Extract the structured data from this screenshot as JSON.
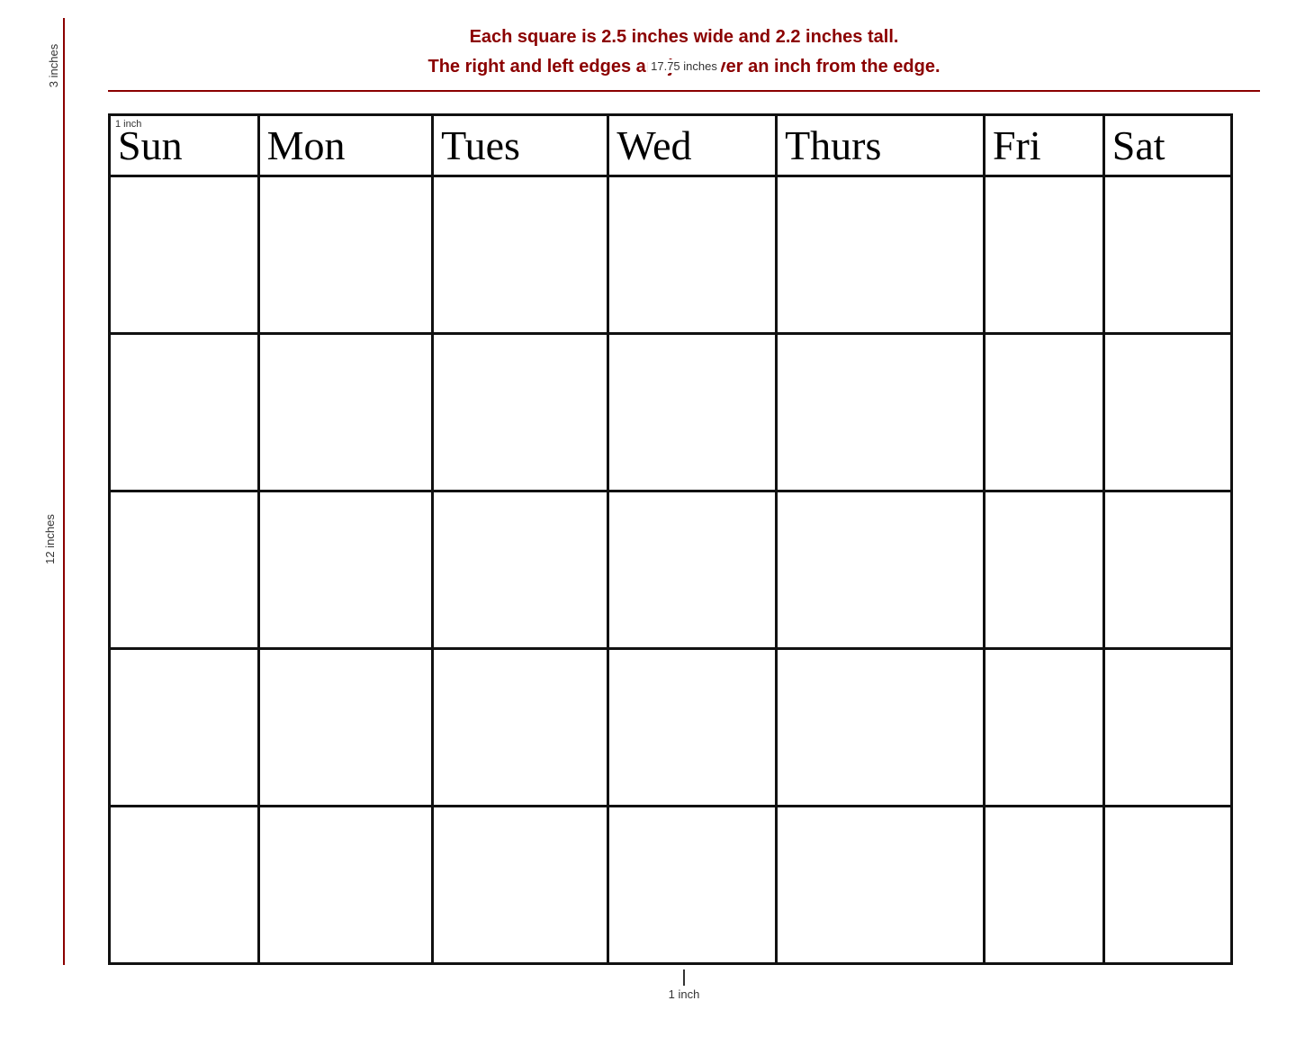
{
  "page": {
    "background": "#ffffff"
  },
  "top_annotations": {
    "line1": "Each square is 2.5 inches wide and 2.2 inches tall.",
    "line2": "The right and left edges are just over an inch from the edge.",
    "horizontal_label": "17.75 inches",
    "vertical_label": "3 inches"
  },
  "left_annotation": {
    "label": "12 inches"
  },
  "bottom_annotation": {
    "label": "1 inch"
  },
  "calendar": {
    "days": [
      "Sun",
      "Mon",
      "Tues",
      "Wed",
      "Thurs",
      "Fri",
      "Sat"
    ],
    "rows": 5,
    "one_inch_label": "1 inch"
  }
}
